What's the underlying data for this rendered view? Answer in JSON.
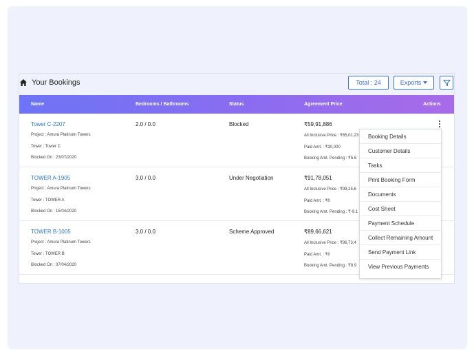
{
  "header": {
    "title": "Your Bookings",
    "total_label": "Total : 24",
    "exports_label": "Exports"
  },
  "columns": [
    "Name",
    "Bedrooms / Bathrooms",
    "Status",
    "Agreement Price",
    "Actions"
  ],
  "rows": [
    {
      "name": "Tower C-2207",
      "project": "Project : Amura Platinum Towers",
      "tower": "Tower : Tower C",
      "blocked_on": "Blocked On : 23/07/2020",
      "bed_bath": "2.0 / 0.0",
      "status": "Blocked",
      "price": "₹59,91,886",
      "all_inclusive": "All Inclusive Price : ₹65,01,23",
      "paid": "Paid Amt. : ₹30,000",
      "pending": "Booking Amt. Pending : ₹5.6"
    },
    {
      "name": "TOWER A-1905",
      "project": "Project : Amura Platinum Towers",
      "tower": "Tower : TOWER A",
      "blocked_on": "Blocked On : 15/04/2020",
      "bed_bath": "3.0 / 0.0",
      "status": "Under Negotiation",
      "price": "₹91,78,051",
      "all_inclusive": "All Inclusive Price : ₹99,25,6",
      "paid": "Paid Amt. : ₹0",
      "pending": "Booking Amt. Pending : ₹-9.1"
    },
    {
      "name": "TOWER B-1005",
      "project": "Project : Amura Platinum Towers",
      "tower": "Tower : TOWER B",
      "blocked_on": "Blocked On : 07/04/2020",
      "bed_bath": "3.0 / 0.0",
      "status": "Scheme Approved",
      "price": "₹89,66,621",
      "all_inclusive": "All Inclusive Price : ₹96,73,4",
      "paid": "Paid Amt. : ₹0",
      "pending": "Booking Amt. Pending : ₹8.9"
    }
  ],
  "actions_menu": [
    "Booking Details",
    "Customer Details",
    "Tasks",
    "Print Booking Form",
    "Documents",
    "Cost Sheet",
    "Payment Schedule",
    "Collect Remaining Amount",
    "Send Payment Link",
    "View Previous Payments"
  ],
  "colors": {
    "accent": "#3b6fd0",
    "header_gradient_start": "#6d74f5",
    "header_gradient_end": "#a86be8",
    "link": "#2a78c8"
  }
}
